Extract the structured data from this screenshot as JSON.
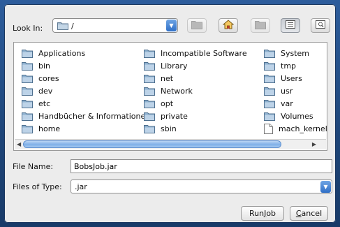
{
  "look_in": {
    "label": "Look In:",
    "path": "/",
    "icon": "folder-icon"
  },
  "toolbar": [
    {
      "name": "up-folder-button",
      "icon": "up-folder-icon",
      "enabled": false
    },
    {
      "name": "home-button",
      "icon": "home-icon",
      "enabled": true
    },
    {
      "name": "new-folder-button",
      "icon": "new-folder-icon",
      "enabled": false
    },
    {
      "name": "list-view-button",
      "icon": "list-view-icon",
      "selected": true
    },
    {
      "name": "details-view-button",
      "icon": "details-view-icon",
      "selected": false
    }
  ],
  "files": {
    "col1": [
      "Applications",
      "bin",
      "cores",
      "dev",
      "etc",
      "Handbücher & Informationen",
      "home"
    ],
    "col2": [
      "Incompatible Software",
      "Library",
      "net",
      "Network",
      "opt",
      "private",
      "sbin"
    ],
    "col3": [
      "System",
      "tmp",
      "Users",
      "usr",
      "var",
      "Volumes",
      "mach_kernel"
    ],
    "col3_types": [
      "folder",
      "folder",
      "folder",
      "folder",
      "folder",
      "folder",
      "file"
    ]
  },
  "file_name": {
    "label": "File Name:",
    "value": "BobsJob.jar"
  },
  "file_type": {
    "label": "Files of Type:",
    "value": ".jar"
  },
  "buttons": {
    "run_pre": "Run ",
    "run_mn": "J",
    "run_post": "ob",
    "cancel_mn": "C",
    "cancel_post": "ancel"
  },
  "colors": {
    "accent": "#3a7bd5",
    "background": "#ececec",
    "desktop": "#244f86"
  }
}
